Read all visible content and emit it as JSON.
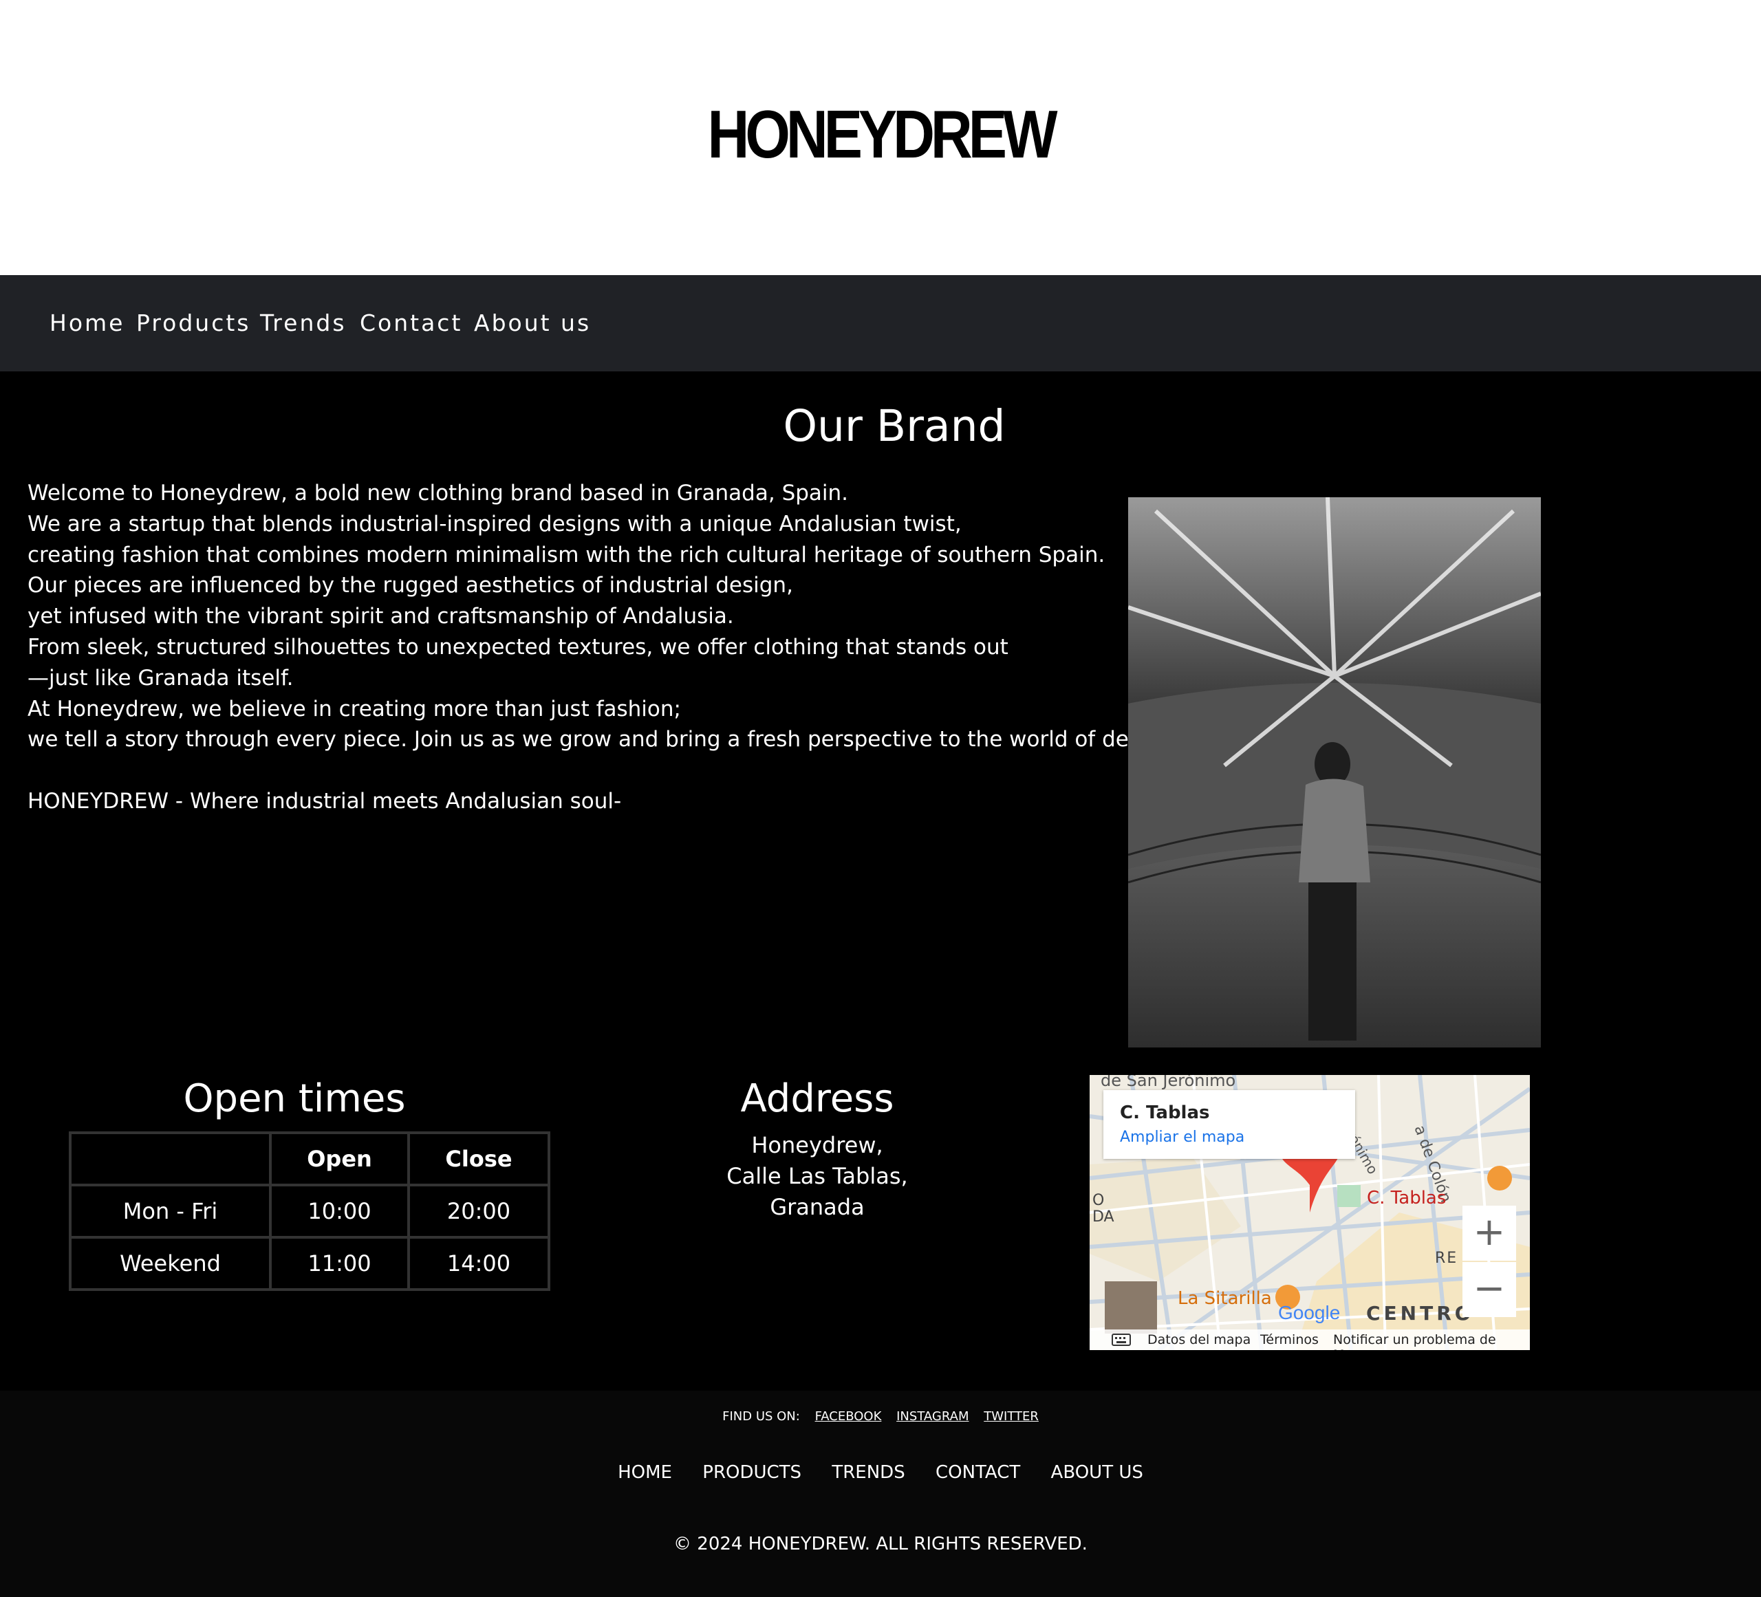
{
  "header": {
    "logo": "HONEYDREW"
  },
  "nav": {
    "items": [
      "Home",
      "Products",
      "Trends",
      "Contact",
      "About us"
    ]
  },
  "brand": {
    "title": "Our Brand",
    "paragraphs": [
      "Welcome to Honeydrew, a bold new clothing brand based in Granada, Spain.",
      "We are a startup that blends industrial-inspired designs with a unique Andalusian twist,",
      "creating fashion that combines modern minimalism with the rich cultural heritage of southern Spain.",
      "Our pieces are influenced by the rugged aesthetics of industrial design,",
      "yet infused with the vibrant spirit and craftsmanship of Andalusia.",
      "From sleek, structured silhouettes to unexpected textures, we offer clothing that stands out",
      "—just like Granada itself.",
      "At Honeydrew, we believe in creating more than just fashion;",
      "we tell a story through every piece. Join us as we grow and bring a fresh perspective to the world of design."
    ],
    "tagline": "HONEYDREW - Where industrial meets Andalusian soul-"
  },
  "hours": {
    "title": "Open times",
    "headers": [
      "",
      "Open",
      "Close"
    ],
    "rows": [
      [
        "Mon - Fri",
        "10:00",
        "20:00"
      ],
      [
        "Weekend",
        "11:00",
        "14:00"
      ]
    ]
  },
  "address": {
    "title": "Address",
    "lines": [
      "Honeydrew,",
      "Calle Las Tablas,",
      "Granada"
    ]
  },
  "map": {
    "card_title": "C. Tablas",
    "card_link": "Ampliar el mapa",
    "pin_label": "C. Tablas",
    "street_top": "de San Jerónimo",
    "street_colon": "a de Colón",
    "street_jeronimo": "Jerónimo",
    "area_centro": "CENTRO",
    "area_re": "RE",
    "area_left_a": "O",
    "area_left_b": "DA",
    "poi": "La Sitarilla",
    "google": "Google",
    "attribution": [
      "Datos del mapa",
      "Términos",
      "Notificar un problema de Maps"
    ],
    "zoom_in": "+",
    "zoom_out": "−"
  },
  "footer": {
    "find_us": "FIND US ON:",
    "social": [
      "FACEBOOK",
      "INSTAGRAM",
      "TWITTER"
    ],
    "nav": [
      "HOME",
      "PRODUCTS",
      "TRENDS",
      "CONTACT",
      "ABOUT US"
    ],
    "copyright": "© 2024 HONEYDREW. ALL RIGHTS RESERVED."
  }
}
